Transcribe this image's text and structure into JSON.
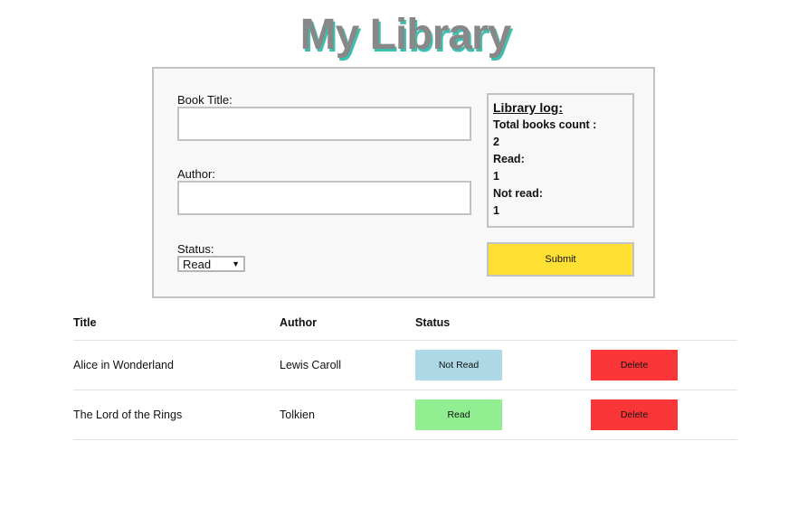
{
  "app": {
    "title": "My Library"
  },
  "colors": {
    "title_fill": "#888888",
    "title_shadow": "#3dbfb0",
    "submit_bg": "#ffe033",
    "not_read_bg": "#add8e6",
    "read_bg": "#90ee90",
    "delete_bg": "#fb3639"
  },
  "form": {
    "title_label": "Book Title:",
    "title_value": "",
    "author_label": "Author:",
    "author_value": "",
    "status_label": "Status:",
    "status_selected": "Read",
    "submit_label": "Submit"
  },
  "log": {
    "title": "Library log:",
    "total_label": "Total books count :",
    "total_value": "2",
    "read_label": "Read:",
    "read_value": "1",
    "not_read_label": "Not read:",
    "not_read_value": "1"
  },
  "table": {
    "headers": [
      "Title",
      "Author",
      "Status"
    ],
    "rows": [
      {
        "title": "Alice in Wonderland",
        "author": "Lewis Caroll",
        "status": "Not Read",
        "status_color": "#add8e6",
        "delete": "Delete"
      },
      {
        "title": "The Lord of the Rings",
        "author": "Tolkien",
        "status": "Read",
        "status_color": "#90ee90",
        "delete": "Delete"
      }
    ]
  }
}
